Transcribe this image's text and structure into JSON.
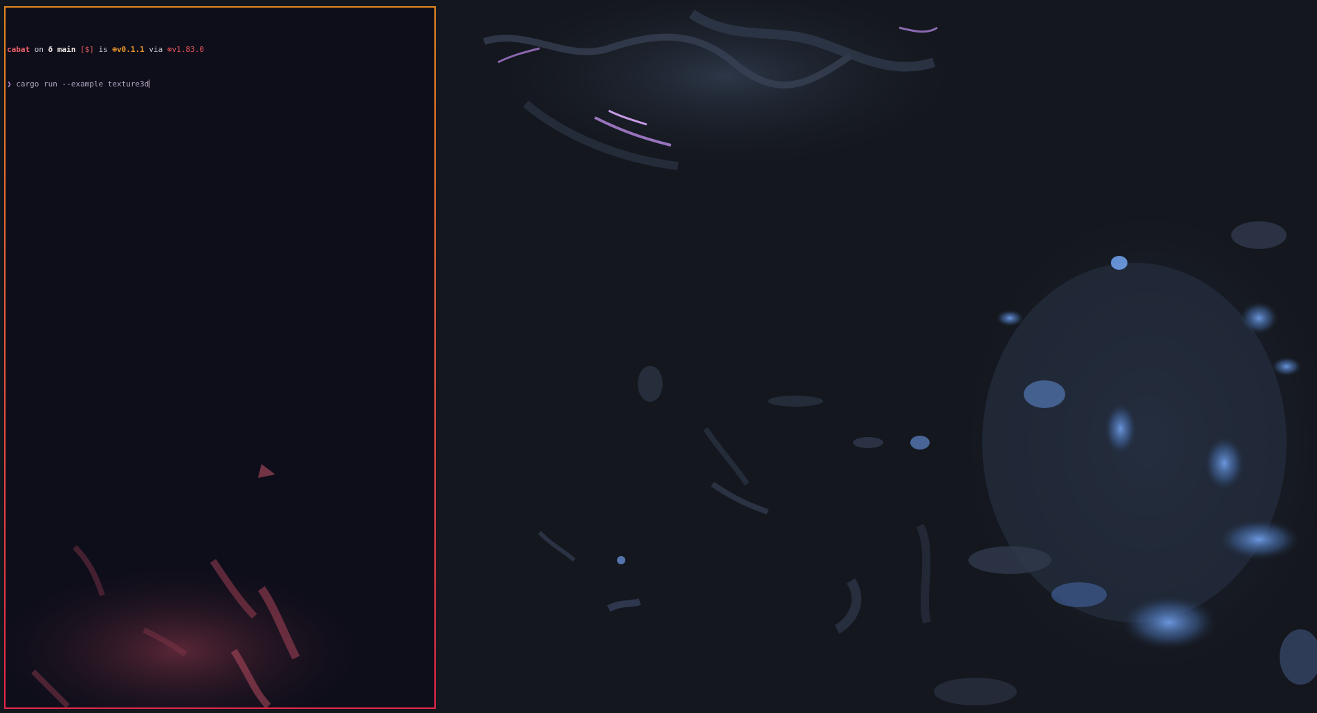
{
  "desktop": {
    "wallpaper_colors": {
      "background": "#14171e",
      "blue_highlight": "#6f9de8",
      "purple_highlight": "#b084d8",
      "red_highlight": "#c2485e",
      "dark_slate": "#2b3444"
    }
  },
  "terminal": {
    "border_colors": [
      "#e8891f",
      "#e6284a"
    ],
    "prompt": {
      "user_dir": "cabat",
      "on_word": "on",
      "branch_icon": "ð",
      "branch": "main",
      "git_status": "[$]",
      "is_word": "is",
      "package_icon": "📦",
      "package_version": "v0.1.1",
      "via_word": "via",
      "rust_icon": "⚙",
      "rust_version": "v1.83.0"
    },
    "command_line": {
      "prompt_char": "❯",
      "command": "cargo run --example texture3d"
    }
  }
}
